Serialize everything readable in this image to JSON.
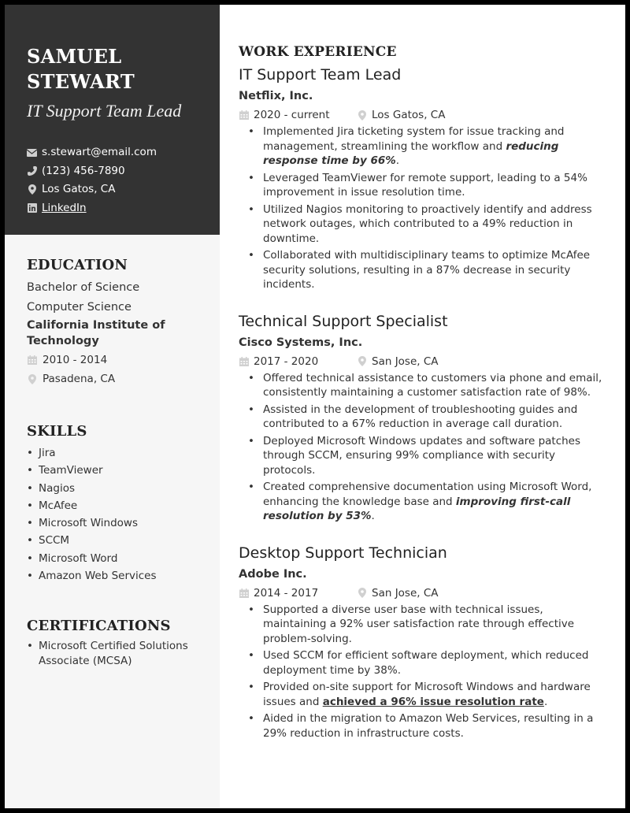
{
  "profile": {
    "first_name": "SAMUEL",
    "last_name": "STEWART",
    "title": "IT Support Team Lead",
    "email": "s.stewart@email.com",
    "phone": "(123) 456-7890",
    "location": "Los Gatos, CA",
    "linkedin": "LinkedIn"
  },
  "education": {
    "heading": "EDUCATION",
    "degree": "Bachelor of Science",
    "field": "Computer Science",
    "school": "California Institute of Technology",
    "dates": "2010 - 2014",
    "location": "Pasadena, CA"
  },
  "skills": {
    "heading": "SKILLS",
    "items": [
      "Jira",
      "TeamViewer",
      "Nagios",
      "McAfee",
      "Microsoft Windows",
      "SCCM",
      "Microsoft Word",
      "Amazon Web Services"
    ]
  },
  "certifications": {
    "heading": "CERTIFICATIONS",
    "items": [
      "Microsoft Certified Solutions Associate (MCSA)"
    ]
  },
  "work": {
    "heading": "WORK EXPERIENCE",
    "jobs": [
      {
        "title": "IT Support Team Lead",
        "company": "Netflix, Inc.",
        "dates": "2020 - current",
        "location": "Los Gatos, CA",
        "bullets": [
          {
            "pre": "Implemented Jira ticketing system for issue tracking and management, streamlining the workflow and ",
            "em": "reducing response time by 66%",
            "post": "."
          },
          {
            "pre": "Leveraged TeamViewer for remote support, leading to a 54% improvement in issue resolution time.",
            "em": "",
            "post": ""
          },
          {
            "pre": "Utilized Nagios monitoring to proactively identify and address network outages, which contributed to a 49% reduction in downtime.",
            "em": "",
            "post": ""
          },
          {
            "pre": "Collaborated with multidisciplinary teams to optimize McAfee security solutions, resulting in a 87% decrease in security incidents.",
            "em": "",
            "post": ""
          }
        ]
      },
      {
        "title": "Technical Support Specialist",
        "company": "Cisco Systems, Inc.",
        "dates": "2017 - 2020",
        "location": "San Jose, CA",
        "bullets": [
          {
            "pre": "Offered technical assistance to customers via phone and email, consistently maintaining a customer satisfaction rate of 98%.",
            "em": "",
            "post": ""
          },
          {
            "pre": "Assisted in the development of troubleshooting guides and contributed to a 67% reduction in average call duration.",
            "em": "",
            "post": ""
          },
          {
            "pre": "Deployed Microsoft Windows updates and software patches through SCCM, ensuring 99% compliance with security protocols.",
            "em": "",
            "post": ""
          },
          {
            "pre": "Created comprehensive documentation using Microsoft Word, enhancing the knowledge base and ",
            "em": "improving first-call resolution by 53%",
            "post": "."
          }
        ]
      },
      {
        "title": "Desktop Support Technician",
        "company": "Adobe Inc.",
        "dates": "2014 - 2017",
        "location": "San Jose, CA",
        "bullets": [
          {
            "pre": "Supported a diverse user base with technical issues, maintaining a 92% user satisfaction rate through effective problem-solving.",
            "em": "",
            "post": ""
          },
          {
            "pre": "Used SCCM for efficient software deployment, which reduced deployment time by 38%.",
            "em": "",
            "post": ""
          },
          {
            "pre": "Provided on-site support for Microsoft Windows and hardware issues and ",
            "u": "achieved a 96% issue resolution rate",
            "post": "."
          },
          {
            "pre": "Aided in the migration to Amazon Web Services, resulting in a 29% reduction in infrastructure costs.",
            "em": "",
            "post": ""
          }
        ]
      }
    ]
  }
}
